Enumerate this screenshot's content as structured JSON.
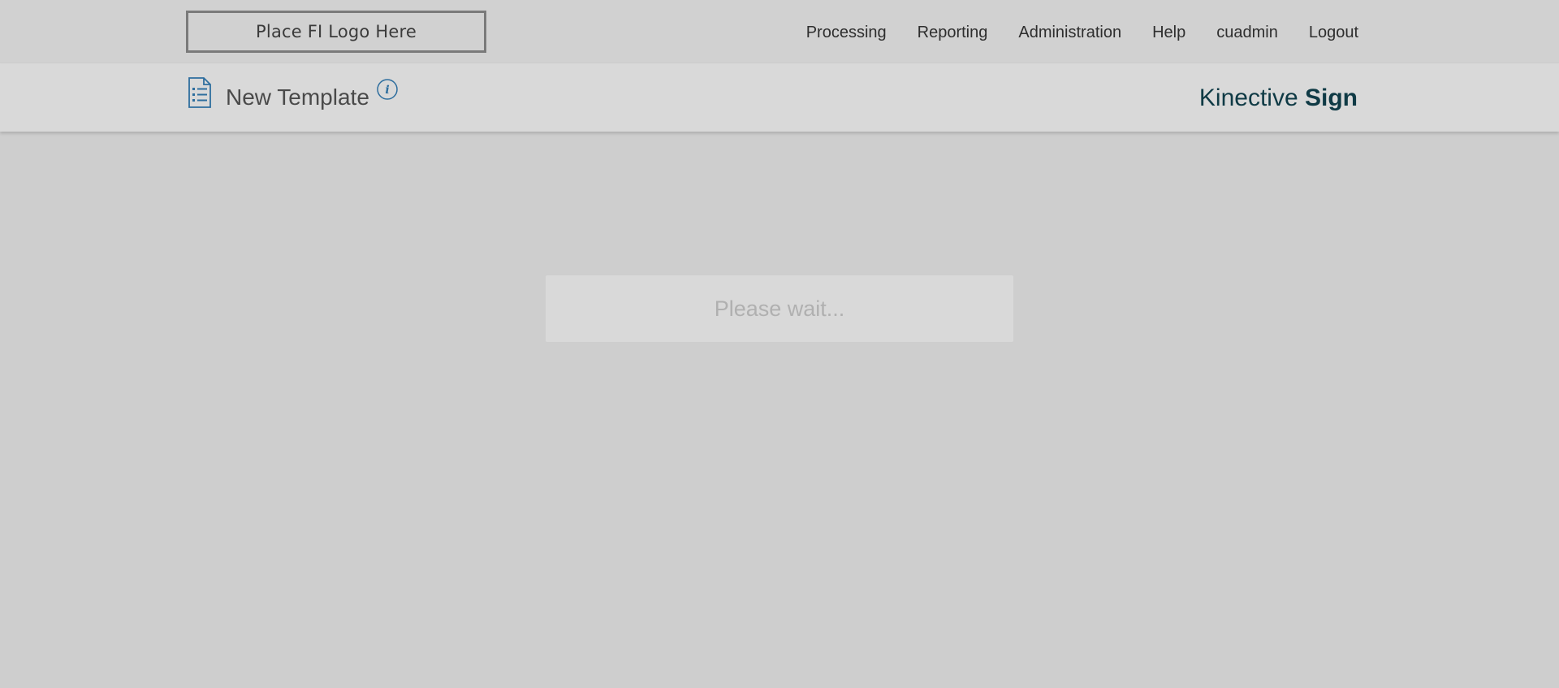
{
  "header": {
    "logo_text": "Place FI Logo Here",
    "nav": [
      {
        "label": "Processing"
      },
      {
        "label": "Reporting"
      },
      {
        "label": "Administration"
      },
      {
        "label": "Help"
      },
      {
        "label": "cuadmin"
      },
      {
        "label": "Logout"
      }
    ]
  },
  "subheader": {
    "title": "New Template",
    "title_icon": "document-list-icon",
    "info_icon": "info-icon",
    "brand_light": "Kinective",
    "brand_bold": "Sign"
  },
  "loading": {
    "message": "Please wait..."
  },
  "colors": {
    "accent": "#2e6e9e",
    "brand": "#0f3a45",
    "background": "#cecece"
  }
}
